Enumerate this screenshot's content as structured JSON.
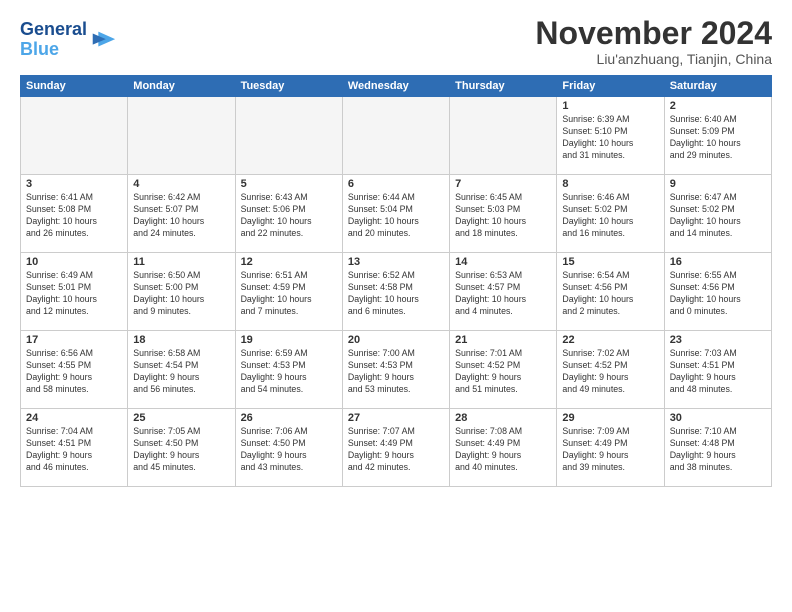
{
  "header": {
    "logo_line1": "General",
    "logo_line2": "Blue",
    "month": "November 2024",
    "location": "Liu'anzhuang, Tianjin, China"
  },
  "days_of_week": [
    "Sunday",
    "Monday",
    "Tuesday",
    "Wednesday",
    "Thursday",
    "Friday",
    "Saturday"
  ],
  "weeks": [
    [
      {
        "day": "",
        "info": ""
      },
      {
        "day": "",
        "info": ""
      },
      {
        "day": "",
        "info": ""
      },
      {
        "day": "",
        "info": ""
      },
      {
        "day": "",
        "info": ""
      },
      {
        "day": "1",
        "info": "Sunrise: 6:39 AM\nSunset: 5:10 PM\nDaylight: 10 hours\nand 31 minutes."
      },
      {
        "day": "2",
        "info": "Sunrise: 6:40 AM\nSunset: 5:09 PM\nDaylight: 10 hours\nand 29 minutes."
      }
    ],
    [
      {
        "day": "3",
        "info": "Sunrise: 6:41 AM\nSunset: 5:08 PM\nDaylight: 10 hours\nand 26 minutes."
      },
      {
        "day": "4",
        "info": "Sunrise: 6:42 AM\nSunset: 5:07 PM\nDaylight: 10 hours\nand 24 minutes."
      },
      {
        "day": "5",
        "info": "Sunrise: 6:43 AM\nSunset: 5:06 PM\nDaylight: 10 hours\nand 22 minutes."
      },
      {
        "day": "6",
        "info": "Sunrise: 6:44 AM\nSunset: 5:04 PM\nDaylight: 10 hours\nand 20 minutes."
      },
      {
        "day": "7",
        "info": "Sunrise: 6:45 AM\nSunset: 5:03 PM\nDaylight: 10 hours\nand 18 minutes."
      },
      {
        "day": "8",
        "info": "Sunrise: 6:46 AM\nSunset: 5:02 PM\nDaylight: 10 hours\nand 16 minutes."
      },
      {
        "day": "9",
        "info": "Sunrise: 6:47 AM\nSunset: 5:02 PM\nDaylight: 10 hours\nand 14 minutes."
      }
    ],
    [
      {
        "day": "10",
        "info": "Sunrise: 6:49 AM\nSunset: 5:01 PM\nDaylight: 10 hours\nand 12 minutes."
      },
      {
        "day": "11",
        "info": "Sunrise: 6:50 AM\nSunset: 5:00 PM\nDaylight: 10 hours\nand 9 minutes."
      },
      {
        "day": "12",
        "info": "Sunrise: 6:51 AM\nSunset: 4:59 PM\nDaylight: 10 hours\nand 7 minutes."
      },
      {
        "day": "13",
        "info": "Sunrise: 6:52 AM\nSunset: 4:58 PM\nDaylight: 10 hours\nand 6 minutes."
      },
      {
        "day": "14",
        "info": "Sunrise: 6:53 AM\nSunset: 4:57 PM\nDaylight: 10 hours\nand 4 minutes."
      },
      {
        "day": "15",
        "info": "Sunrise: 6:54 AM\nSunset: 4:56 PM\nDaylight: 10 hours\nand 2 minutes."
      },
      {
        "day": "16",
        "info": "Sunrise: 6:55 AM\nSunset: 4:56 PM\nDaylight: 10 hours\nand 0 minutes."
      }
    ],
    [
      {
        "day": "17",
        "info": "Sunrise: 6:56 AM\nSunset: 4:55 PM\nDaylight: 9 hours\nand 58 minutes."
      },
      {
        "day": "18",
        "info": "Sunrise: 6:58 AM\nSunset: 4:54 PM\nDaylight: 9 hours\nand 56 minutes."
      },
      {
        "day": "19",
        "info": "Sunrise: 6:59 AM\nSunset: 4:53 PM\nDaylight: 9 hours\nand 54 minutes."
      },
      {
        "day": "20",
        "info": "Sunrise: 7:00 AM\nSunset: 4:53 PM\nDaylight: 9 hours\nand 53 minutes."
      },
      {
        "day": "21",
        "info": "Sunrise: 7:01 AM\nSunset: 4:52 PM\nDaylight: 9 hours\nand 51 minutes."
      },
      {
        "day": "22",
        "info": "Sunrise: 7:02 AM\nSunset: 4:52 PM\nDaylight: 9 hours\nand 49 minutes."
      },
      {
        "day": "23",
        "info": "Sunrise: 7:03 AM\nSunset: 4:51 PM\nDaylight: 9 hours\nand 48 minutes."
      }
    ],
    [
      {
        "day": "24",
        "info": "Sunrise: 7:04 AM\nSunset: 4:51 PM\nDaylight: 9 hours\nand 46 minutes."
      },
      {
        "day": "25",
        "info": "Sunrise: 7:05 AM\nSunset: 4:50 PM\nDaylight: 9 hours\nand 45 minutes."
      },
      {
        "day": "26",
        "info": "Sunrise: 7:06 AM\nSunset: 4:50 PM\nDaylight: 9 hours\nand 43 minutes."
      },
      {
        "day": "27",
        "info": "Sunrise: 7:07 AM\nSunset: 4:49 PM\nDaylight: 9 hours\nand 42 minutes."
      },
      {
        "day": "28",
        "info": "Sunrise: 7:08 AM\nSunset: 4:49 PM\nDaylight: 9 hours\nand 40 minutes."
      },
      {
        "day": "29",
        "info": "Sunrise: 7:09 AM\nSunset: 4:49 PM\nDaylight: 9 hours\nand 39 minutes."
      },
      {
        "day": "30",
        "info": "Sunrise: 7:10 AM\nSunset: 4:48 PM\nDaylight: 9 hours\nand 38 minutes."
      }
    ]
  ]
}
